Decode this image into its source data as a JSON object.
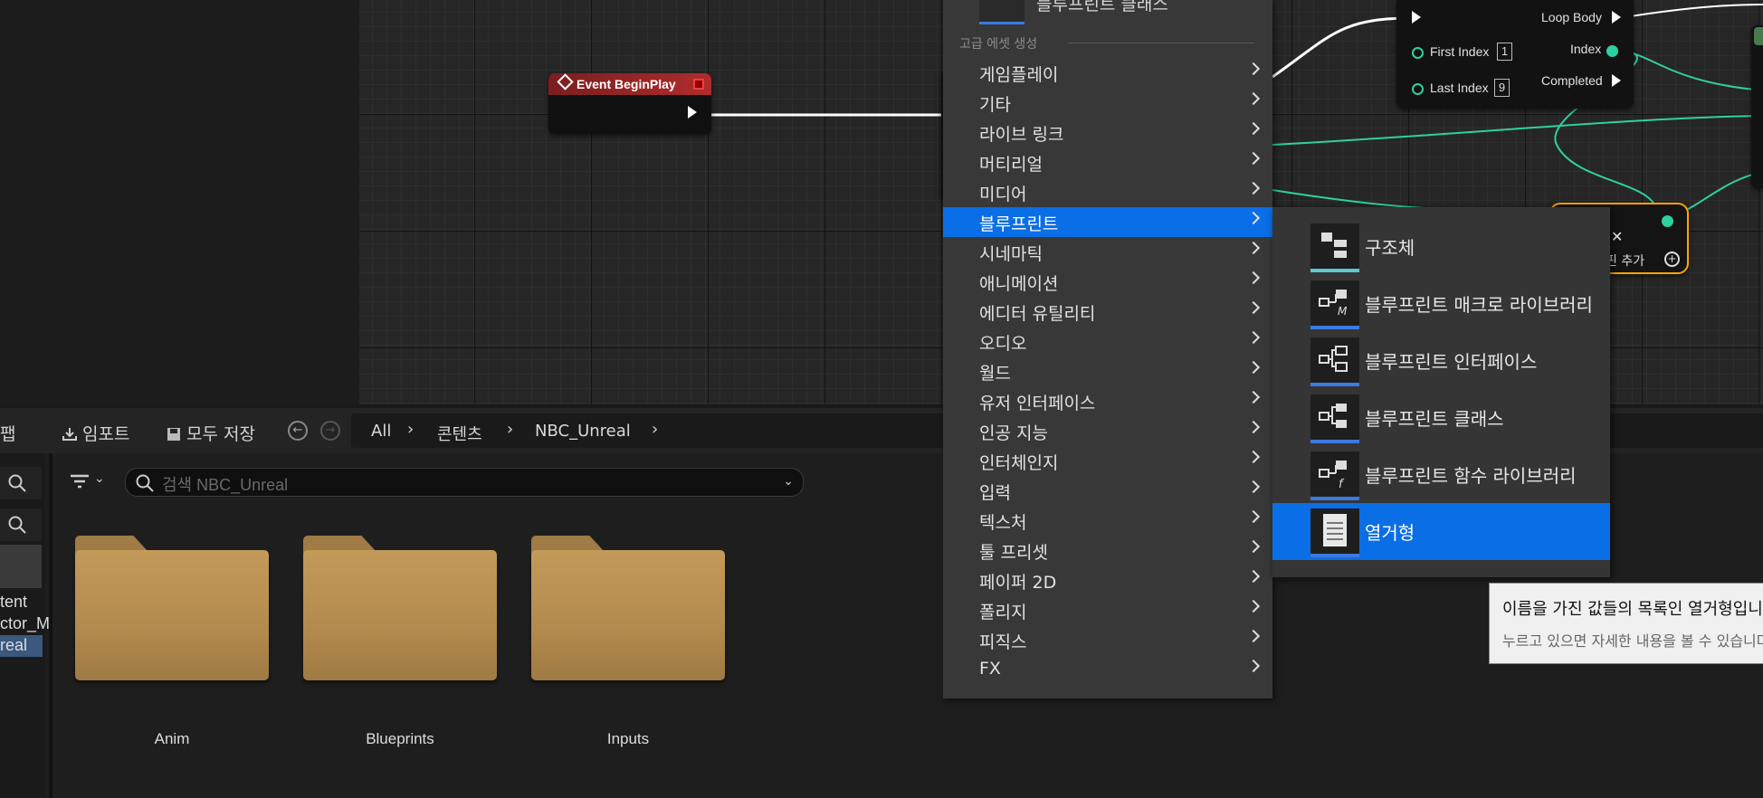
{
  "graph": {
    "event_node": {
      "title": "Event BeginPlay"
    },
    "loop_node": {
      "loop_body": "Loop Body",
      "first_index": "First Index",
      "first_index_val": "1",
      "last_index": "Last Index",
      "last_index_val": "9",
      "index": "Index",
      "completed": "Completed"
    },
    "add_node": {
      "add_pin": "핀 추가",
      "close": "✕"
    }
  },
  "context_menu": {
    "top_item": "블루프린트 클래스",
    "section_header": "고급 에셋 생성",
    "items": [
      {
        "label": "게임플레이"
      },
      {
        "label": "기타"
      },
      {
        "label": "라이브 링크"
      },
      {
        "label": "머티리얼"
      },
      {
        "label": "미디어"
      },
      {
        "label": "블루프린트"
      },
      {
        "label": "시네마틱"
      },
      {
        "label": "애니메이션"
      },
      {
        "label": "에디터 유틸리티"
      },
      {
        "label": "오디오"
      },
      {
        "label": "월드"
      },
      {
        "label": "유저 인터페이스"
      },
      {
        "label": "인공 지능"
      },
      {
        "label": "인터체인지"
      },
      {
        "label": "입력"
      },
      {
        "label": "텍스처"
      },
      {
        "label": "툴 프리셋"
      },
      {
        "label": "페이퍼 2D"
      },
      {
        "label": "폴리지"
      },
      {
        "label": "피직스"
      },
      {
        "label": "FX"
      }
    ],
    "selected_index": 5
  },
  "submenu": {
    "items": [
      {
        "label": "구조체",
        "icon": "struct-icon",
        "bar_color": "#5ec8d0"
      },
      {
        "label": "블루프린트 매크로 라이브러리",
        "icon": "macro-library-icon",
        "bar_color": "#3b7be0"
      },
      {
        "label": "블루프린트 인터페이스",
        "icon": "interface-icon",
        "bar_color": "#3b7be0"
      },
      {
        "label": "블루프린트 클래스",
        "icon": "blueprint-class-icon",
        "bar_color": "#3b7be0"
      },
      {
        "label": "블루프린트 함수 라이브러리",
        "icon": "function-library-icon",
        "bar_color": "#3b7be0"
      },
      {
        "label": "열거형",
        "icon": "enum-icon",
        "bar_color": "#3b7be0"
      }
    ],
    "selected_index": 5
  },
  "tooltip": {
    "line1": "이름을 가진 값들의 목록인 열거형입니다",
    "line2": "누르고 있으면 자세한 내용을 볼 수 있습니다"
  },
  "content_browser": {
    "toolbar": {
      "fab": "팹",
      "import": "임포트",
      "save_all": "모두 저장"
    },
    "breadcrumb": [
      "All",
      "콘텐츠",
      "NBC_Unreal"
    ],
    "search": {
      "placeholder": "검색 NBC_Unreal"
    },
    "tree": [
      "tent",
      "ctor_M",
      "real"
    ],
    "folders": [
      "Anim",
      "Blueprints",
      "Inputs"
    ]
  }
}
